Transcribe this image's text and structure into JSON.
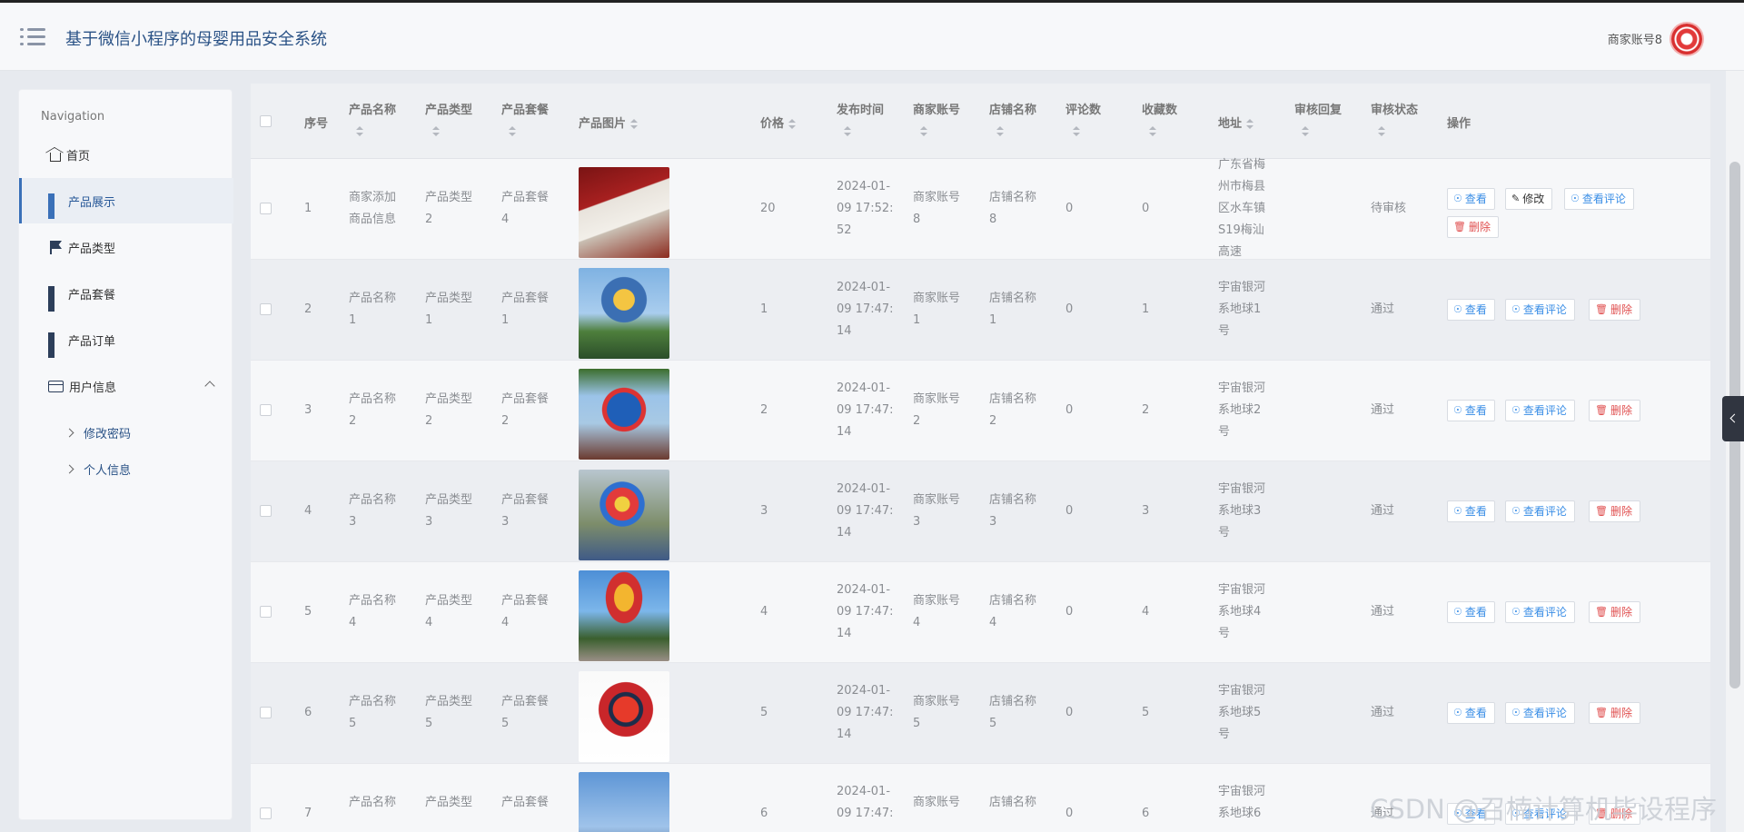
{
  "header": {
    "title": "基于微信小程序的母婴用品安全系统",
    "account": "商家账号8"
  },
  "sidebar": {
    "caption": "Navigation",
    "items": [
      {
        "label": "首页",
        "icon": "home-icon"
      },
      {
        "label": "产品展示",
        "icon": "grid-icon",
        "active": true
      },
      {
        "label": "产品类型",
        "icon": "flag-icon"
      },
      {
        "label": "产品套餐",
        "icon": "grid-icon"
      },
      {
        "label": "产品订单",
        "icon": "grid-icon"
      },
      {
        "label": "用户信息",
        "icon": "card-icon",
        "expanded": true
      }
    ],
    "subitems": [
      {
        "label": "修改密码"
      },
      {
        "label": "个人信息"
      }
    ]
  },
  "table": {
    "headers": {
      "index": "序号",
      "name": "产品名称",
      "type": "产品类型",
      "package": "产品套餐",
      "image": "产品图片",
      "price": "价格",
      "time": "发布时间",
      "merchant": "商家账号",
      "shop": "店铺名称",
      "comments": "评论数",
      "favorites": "收藏数",
      "address": "地址",
      "reply": "审核回复",
      "status": "审核状态",
      "actions": "操作"
    },
    "buttons": {
      "view": "查看",
      "edit": "修改",
      "comment": "查看评论",
      "delete": "删除"
    },
    "rows": [
      {
        "index": "1",
        "name": [
          "商家添加",
          "商品信息"
        ],
        "type": [
          "产品类型",
          "2"
        ],
        "package": [
          "产品套餐",
          "4"
        ],
        "price": "20",
        "time": [
          "2024-01-",
          "09 17:52:",
          "52"
        ],
        "merchant": [
          "商家账号",
          "8"
        ],
        "shop": [
          "店铺名称",
          "8"
        ],
        "comments": "0",
        "favorites": "0",
        "address": [
          "广东省梅",
          "州市梅县",
          "区水车镇",
          "S19梅汕",
          "高速"
        ],
        "status": "待审核"
      },
      {
        "index": "2",
        "name": [
          "产品名称",
          "1"
        ],
        "type": [
          "产品类型",
          "1"
        ],
        "package": [
          "产品套餐",
          "1"
        ],
        "price": "1",
        "time": [
          "2024-01-",
          "09 17:47:",
          "14"
        ],
        "merchant": [
          "商家账号",
          "1"
        ],
        "shop": [
          "店铺名称",
          "1"
        ],
        "comments": "0",
        "favorites": "1",
        "address": [
          "宇宙银河",
          "系地球1",
          "号"
        ],
        "status": "通过"
      },
      {
        "index": "3",
        "name": [
          "产品名称",
          "2"
        ],
        "type": [
          "产品类型",
          "2"
        ],
        "package": [
          "产品套餐",
          "2"
        ],
        "price": "2",
        "time": [
          "2024-01-",
          "09 17:47:",
          "14"
        ],
        "merchant": [
          "商家账号",
          "2"
        ],
        "shop": [
          "店铺名称",
          "2"
        ],
        "comments": "0",
        "favorites": "2",
        "address": [
          "宇宙银河",
          "系地球2",
          "号"
        ],
        "status": "通过"
      },
      {
        "index": "4",
        "name": [
          "产品名称",
          "3"
        ],
        "type": [
          "产品类型",
          "3"
        ],
        "package": [
          "产品套餐",
          "3"
        ],
        "price": "3",
        "time": [
          "2024-01-",
          "09 17:47:",
          "14"
        ],
        "merchant": [
          "商家账号",
          "3"
        ],
        "shop": [
          "店铺名称",
          "3"
        ],
        "comments": "0",
        "favorites": "3",
        "address": [
          "宇宙银河",
          "系地球3",
          "号"
        ],
        "status": "通过"
      },
      {
        "index": "5",
        "name": [
          "产品名称",
          "4"
        ],
        "type": [
          "产品类型",
          "4"
        ],
        "package": [
          "产品套餐",
          "4"
        ],
        "price": "4",
        "time": [
          "2024-01-",
          "09 17:47:",
          "14"
        ],
        "merchant": [
          "商家账号",
          "4"
        ],
        "shop": [
          "店铺名称",
          "4"
        ],
        "comments": "0",
        "favorites": "4",
        "address": [
          "宇宙银河",
          "系地球4",
          "号"
        ],
        "status": "通过"
      },
      {
        "index": "6",
        "name": [
          "产品名称",
          "5"
        ],
        "type": [
          "产品类型",
          "5"
        ],
        "package": [
          "产品套餐",
          "5"
        ],
        "price": "5",
        "time": [
          "2024-01-",
          "09 17:47:",
          "14"
        ],
        "merchant": [
          "商家账号",
          "5"
        ],
        "shop": [
          "店铺名称",
          "5"
        ],
        "comments": "0",
        "favorites": "5",
        "address": [
          "宇宙银河",
          "系地球5",
          "号"
        ],
        "status": "通过"
      },
      {
        "index": "7",
        "name": [
          "产品名称",
          ""
        ],
        "type": [
          "产品类型",
          ""
        ],
        "package": [
          "产品套餐",
          ""
        ],
        "price": "6",
        "time": [
          "2024-01-",
          "09 17:47:",
          ""
        ],
        "merchant": [
          "商家账号",
          ""
        ],
        "shop": [
          "店铺名称",
          ""
        ],
        "comments": "0",
        "favorites": "6",
        "address": [
          "宇宙银河",
          "系地球6",
          ""
        ],
        "status": "通过"
      }
    ]
  },
  "watermark": "CSDN @召楠计算机毕设程序"
}
